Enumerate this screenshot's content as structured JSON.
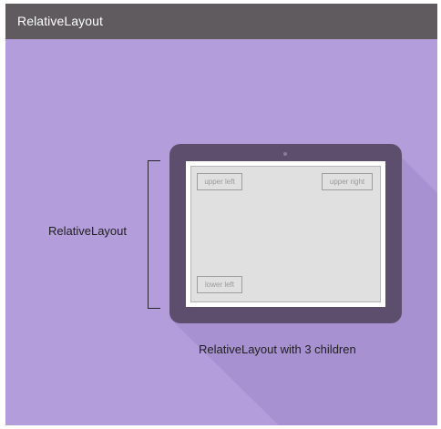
{
  "header": {
    "title": "RelativeLayout"
  },
  "diagram": {
    "bracket_label": "RelativeLayout",
    "children": {
      "upper_left": "upper left",
      "upper_right": "upper right",
      "lower_left": "lower left"
    },
    "caption": "RelativeLayout with 3 children"
  },
  "colors": {
    "background": "#b39ddb",
    "titlebar": "#5f5b5f",
    "tablet_frame": "#5e4e6e",
    "screen_inner": "#e0e0e0"
  }
}
